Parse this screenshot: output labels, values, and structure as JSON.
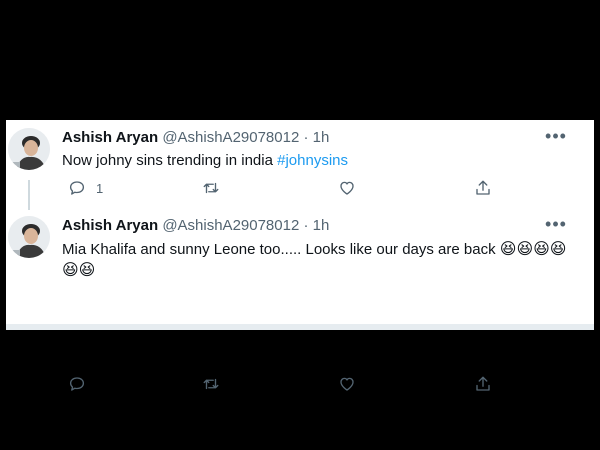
{
  "tweets": [
    {
      "name": "Ashish Aryan",
      "handle": "@AshishA29078012",
      "dot": "·",
      "time": "1h",
      "more": "•••",
      "text": "Now johny sins trending in india",
      "hashtag": "#johnysins",
      "reply_count": "1"
    },
    {
      "name": "Ashish Aryan",
      "handle": "@AshishA29078012",
      "dot": "·",
      "time": "1h",
      "more": "•••",
      "text": "Mia Khalifa and sunny Leone too..... Looks like our days are back",
      "emojis": "😆😆😆😆😆😆"
    }
  ],
  "icons": [
    "reply-icon",
    "retweet-icon",
    "like-icon",
    "share-icon",
    "more-icon"
  ],
  "colors": {
    "text": "#0f1419",
    "secondary": "#536471",
    "link": "#1d9bf0",
    "background": "#000000"
  }
}
